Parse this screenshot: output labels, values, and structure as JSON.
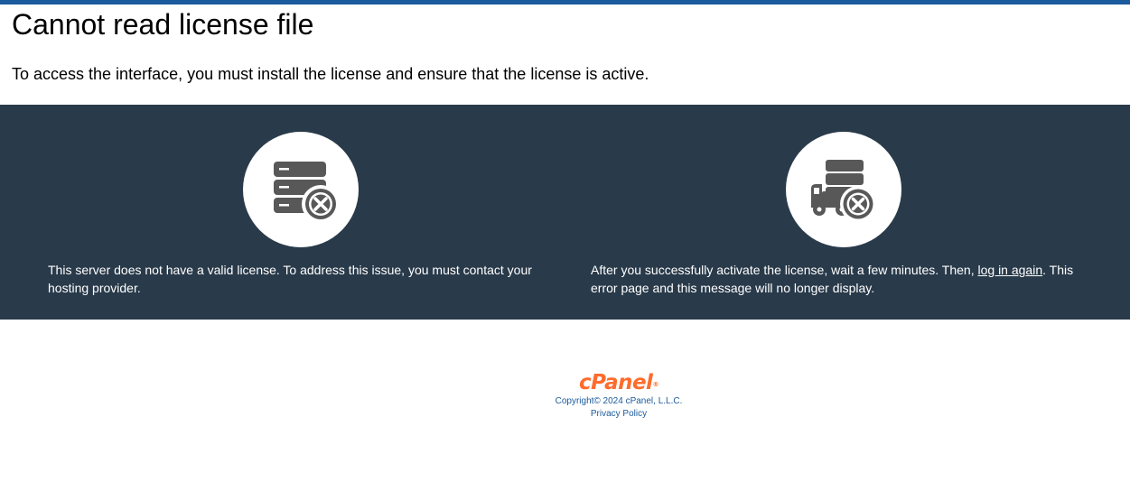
{
  "header": {
    "title": "Cannot read license file",
    "intro": "To access the interface, you must install the license and ensure that the license is active."
  },
  "panel": {
    "left": {
      "icon": "server-error-icon",
      "text": "This server does not have a valid license. To address this issue, you must contact your hosting provider."
    },
    "right": {
      "icon": "server-truck-error-icon",
      "text_before": "After you successfully activate the license, wait a few minutes. Then, ",
      "link_label": "log in again",
      "text_after": ". This error page and this message will no longer display."
    }
  },
  "footer": {
    "logo_text": "cPanel",
    "logo_mark": "®",
    "copyright": "Copyright© 2024 cPanel, L.L.C.",
    "privacy_label": "Privacy Policy"
  },
  "colors": {
    "accent_bar": "#1b5a9c",
    "panel_bg": "#293a4a",
    "icon": "#585858",
    "logo": "#ff6c2c",
    "footer_text": "#1b5a9c"
  }
}
